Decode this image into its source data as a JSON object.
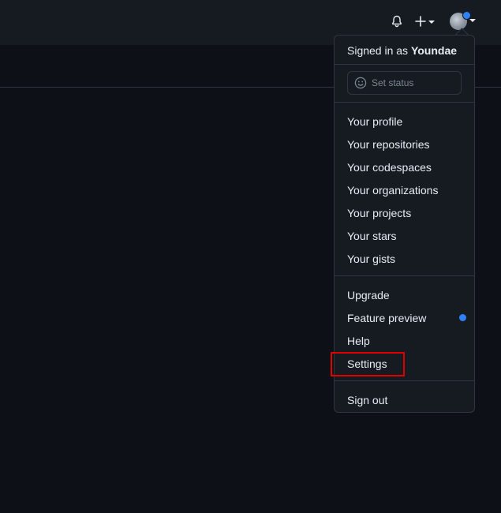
{
  "header": {
    "notifications_icon": "bell-icon",
    "create_icon": "plus-icon",
    "avatar_has_notification": true,
    "accent_color": "#2f81f7"
  },
  "menu": {
    "signed_in_prefix": "Signed in as ",
    "username": "Youndae",
    "status_placeholder": "Set status",
    "status_icon": "smiley-icon",
    "group1": [
      "Your profile",
      "Your repositories",
      "Your codespaces",
      "Your organizations",
      "Your projects",
      "Your stars",
      "Your gists"
    ],
    "group2": [
      "Upgrade",
      "Feature preview",
      "Help",
      "Settings"
    ],
    "feature_preview_has_dot": true,
    "sign_out": "Sign out"
  },
  "annotation": {
    "highlighted_item": "Settings",
    "highlight_color": "#e00000"
  }
}
